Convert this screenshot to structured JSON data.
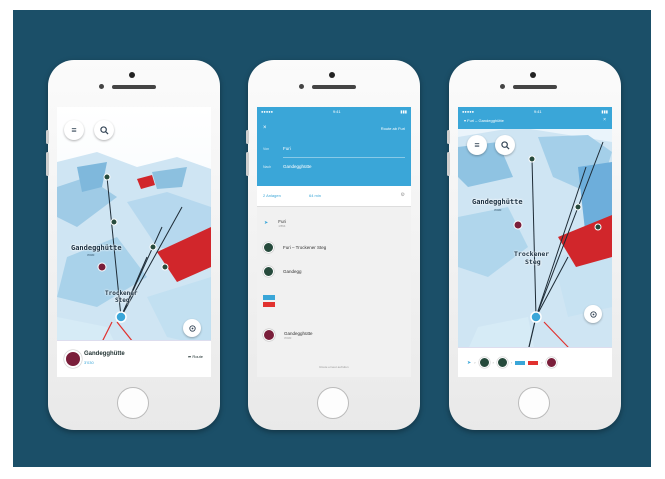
{
  "colors": {
    "background": "#1b4f68",
    "accent": "#3aa6d8",
    "route": "#e1322f"
  },
  "phone1": {
    "menu_icon": "menu-icon",
    "search_icon": "search-icon",
    "map_label_main": "Gandegghütte",
    "map_label_main_alt": "3'030",
    "map_label_second": "Trockener",
    "map_label_second_b": "Steg",
    "card_title": "Gandegghütte",
    "card_subtitle": "3'030",
    "card_action": "Route"
  },
  "phone2": {
    "header_right": "Route ab Furi",
    "from_label": "Von",
    "from_value": "Furi",
    "to_label": "Nach",
    "to_value": "Gandegghütte",
    "tab_left": "2 Anlagen",
    "tab_right": "64 min",
    "steps": [
      {
        "title": "Furi",
        "sub": "1'864"
      },
      {
        "title": "Furi – Trockener Steg",
        "sub": ""
      },
      {
        "title": "Gandegg",
        "sub": ""
      },
      {
        "title": "",
        "sub": ""
      },
      {
        "title": "Gandegghütte",
        "sub": "3'030"
      }
    ],
    "footer": "Route erneut aufrufen"
  },
  "phone3": {
    "header_title": "Furi – Gandegghütte",
    "map_label_main": "Gandegghütte",
    "map_label_main_alt": "3'030",
    "map_label_second": "Trockener",
    "map_label_second_b": "Steg"
  }
}
